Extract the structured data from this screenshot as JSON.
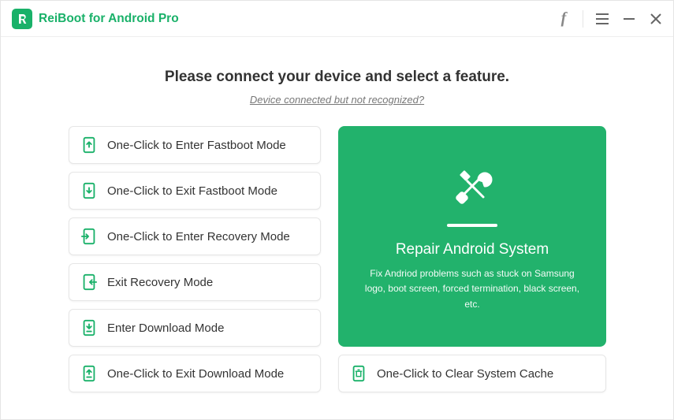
{
  "app": {
    "title": "ReiBoot for Android Pro"
  },
  "titlebar": {
    "facebook": "f",
    "menu": "menu",
    "minimize": "minimize",
    "close": "close"
  },
  "hero": {
    "headline": "Please connect your device and select a feature.",
    "sublink": "Device connected but not recognized?"
  },
  "options": [
    {
      "id": "enter-fastboot",
      "icon": "phone-arrow-up",
      "label": "One-Click to Enter Fastboot Mode"
    },
    {
      "id": "exit-fastboot",
      "icon": "phone-arrow-down",
      "label": "One-Click to Exit Fastboot Mode"
    },
    {
      "id": "enter-recovery",
      "icon": "phone-arrow-in",
      "label": "One-Click to Enter Recovery Mode"
    },
    {
      "id": "exit-recovery",
      "icon": "phone-arrow-out",
      "label": "Exit Recovery Mode"
    },
    {
      "id": "enter-download",
      "icon": "phone-download",
      "label": "Enter Download Mode"
    },
    {
      "id": "exit-download",
      "icon": "phone-download-out",
      "label": "One-Click to Exit Download Mode"
    }
  ],
  "feature": {
    "title": "Repair Android System",
    "desc": "Fix Andriod problems such as stuck on Samsung logo, boot screen, forced termination, black screen, etc."
  },
  "cache": {
    "label": "One-Click to Clear System Cache"
  },
  "colors": {
    "accent": "#19b169",
    "panel": "#22b26c"
  }
}
